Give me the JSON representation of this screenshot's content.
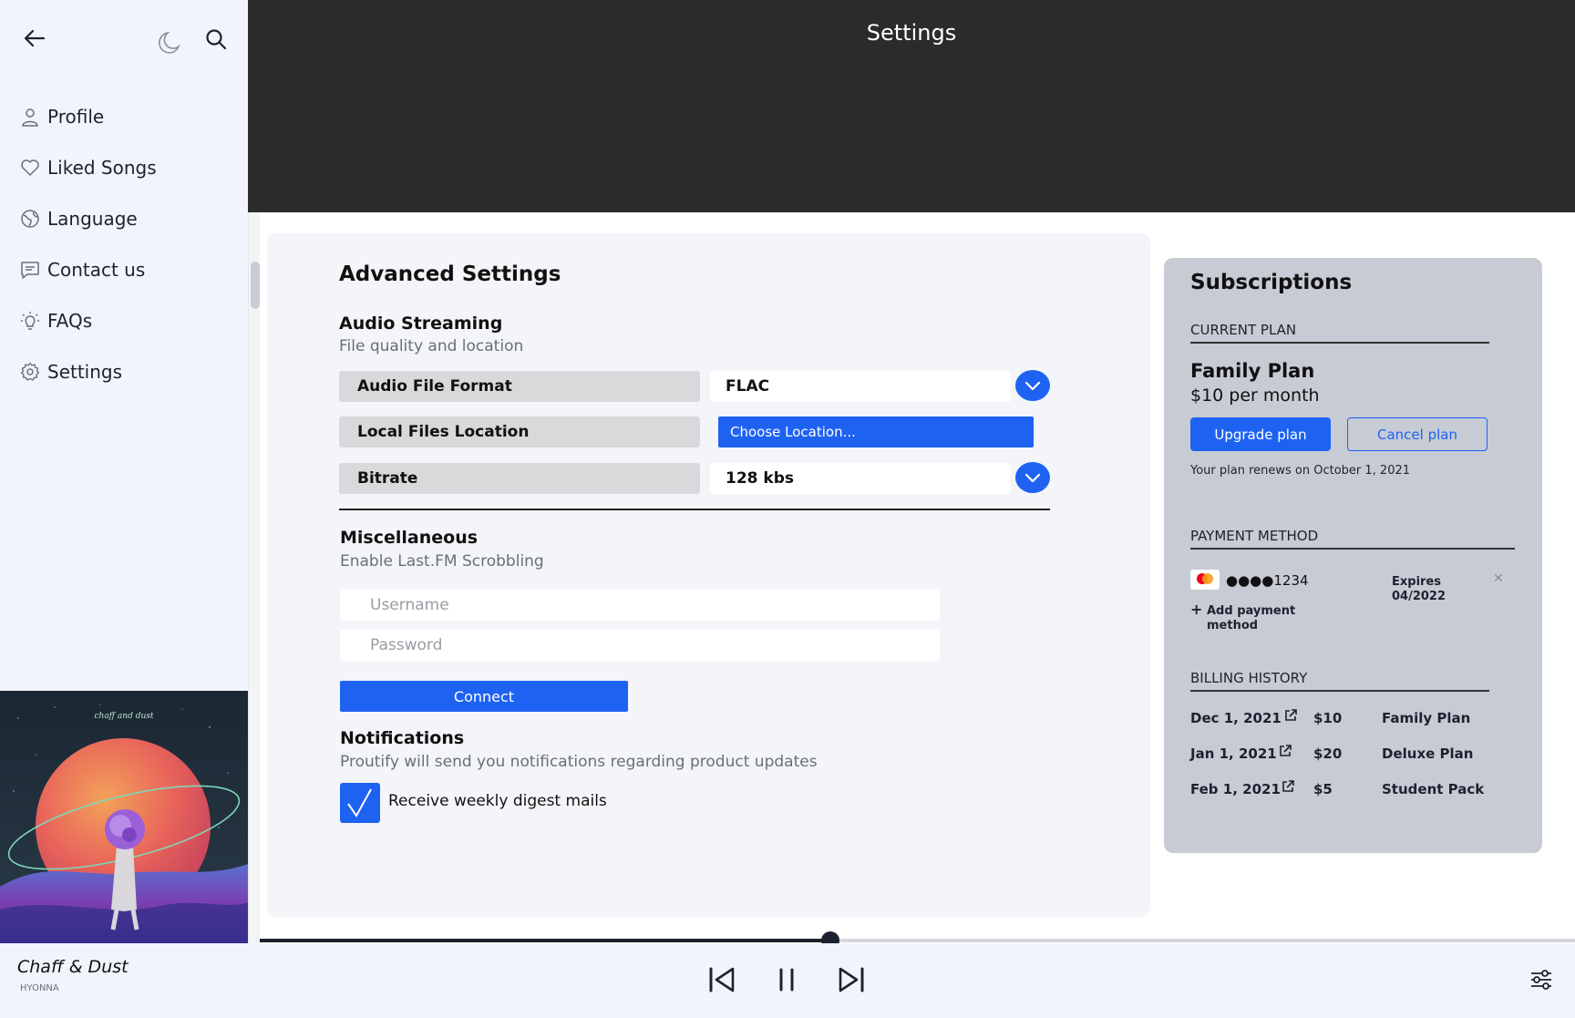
{
  "sidebar": {
    "items": [
      {
        "label": "Profile",
        "icon": "user-icon"
      },
      {
        "label": "Liked Songs",
        "icon": "heart-icon"
      },
      {
        "label": "Language",
        "icon": "globe-icon"
      },
      {
        "label": "Contact us",
        "icon": "message-icon"
      },
      {
        "label": "FAQs",
        "icon": "lightbulb-icon"
      },
      {
        "label": "Settings",
        "icon": "gear-icon"
      }
    ],
    "album_text": "chaff and dust"
  },
  "header": {
    "title": "Settings"
  },
  "advanced": {
    "title": "Advanced Settings",
    "audio": {
      "title": "Audio Streaming",
      "subtitle": "File quality and location",
      "format_label": "Audio File Format",
      "format_value": "FLAC",
      "location_label": "Local Files Location",
      "location_button": "Choose Location...",
      "bitrate_label": "Bitrate",
      "bitrate_value": "128 kbs"
    },
    "misc": {
      "title": "Miscellaneous",
      "subtitle": "Enable Last.FM Scrobbling",
      "username_placeholder": "Username",
      "password_placeholder": "Password",
      "connect_label": "Connect"
    },
    "notifications": {
      "title": "Notifications",
      "subtitle": "Proutify will send you notifications regarding product updates",
      "checkbox_label": "Receive weekly digest mails",
      "checked": true
    }
  },
  "subscriptions": {
    "title": "Subscriptions",
    "current_plan_heading": "CURRENT PLAN",
    "plan_name": "Family Plan",
    "plan_price": "$10 per month",
    "upgrade_label": "Upgrade plan",
    "cancel_label": "Cancel plan",
    "renew_text": "Your plan renews on October 1, 2021",
    "payment_heading": "PAYMENT METHOD",
    "card_number": "●●●●1234",
    "expires_label": "Expires",
    "expires_date": "04/2022",
    "add_payment": "Add payment method",
    "billing_heading": "BILLING HISTORY",
    "billing": [
      {
        "date": "Dec 1, 2021",
        "amount": "$10",
        "plan": "Family Plan"
      },
      {
        "date": "Jan 1, 2021",
        "amount": "$20",
        "plan": "Deluxe Plan"
      },
      {
        "date": "Feb 1, 2021",
        "amount": "$5",
        "plan": "Student Pack"
      }
    ]
  },
  "player": {
    "track_title": "Chaff & Dust",
    "artist": "HYONNA",
    "progress": 0.4
  },
  "colors": {
    "accent": "#1e62f2",
    "header_bg": "#2b2b2b",
    "sidebar_bg": "#f1f5fb",
    "subs_bg": "#c7cbd4"
  }
}
